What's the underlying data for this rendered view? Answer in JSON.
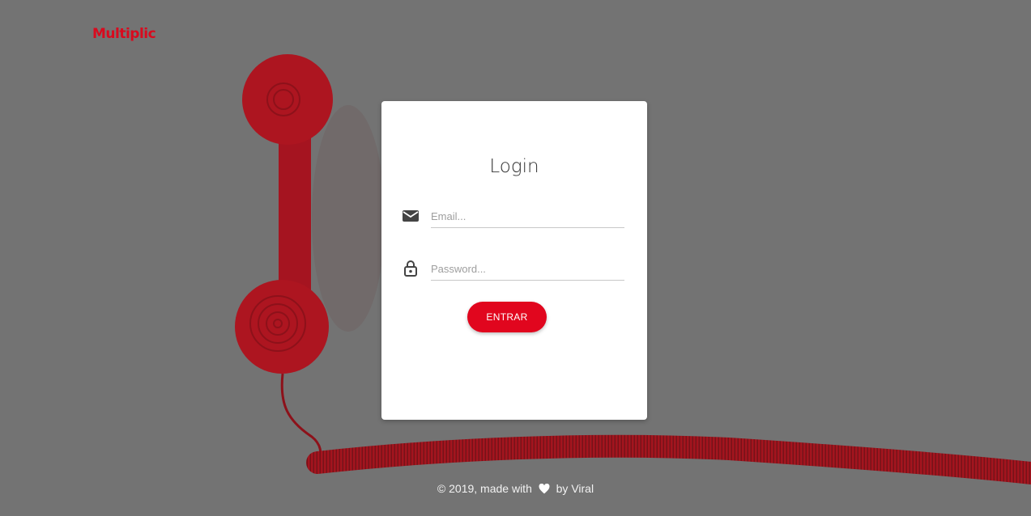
{
  "brand": {
    "name": "Multiplic"
  },
  "login": {
    "title": "Login",
    "email": {
      "placeholder": "Email..."
    },
    "password": {
      "placeholder": "Password..."
    },
    "submit_label": "ENTRAR"
  },
  "footer": {
    "prefix": "© 2019, made with",
    "suffix": "by Viral"
  },
  "icons": {
    "email": "envelope-icon",
    "password": "lock-icon",
    "footer": "heart-icon"
  },
  "colors": {
    "accent": "#e1061e",
    "background": "#737373",
    "card": "#ffffff"
  }
}
